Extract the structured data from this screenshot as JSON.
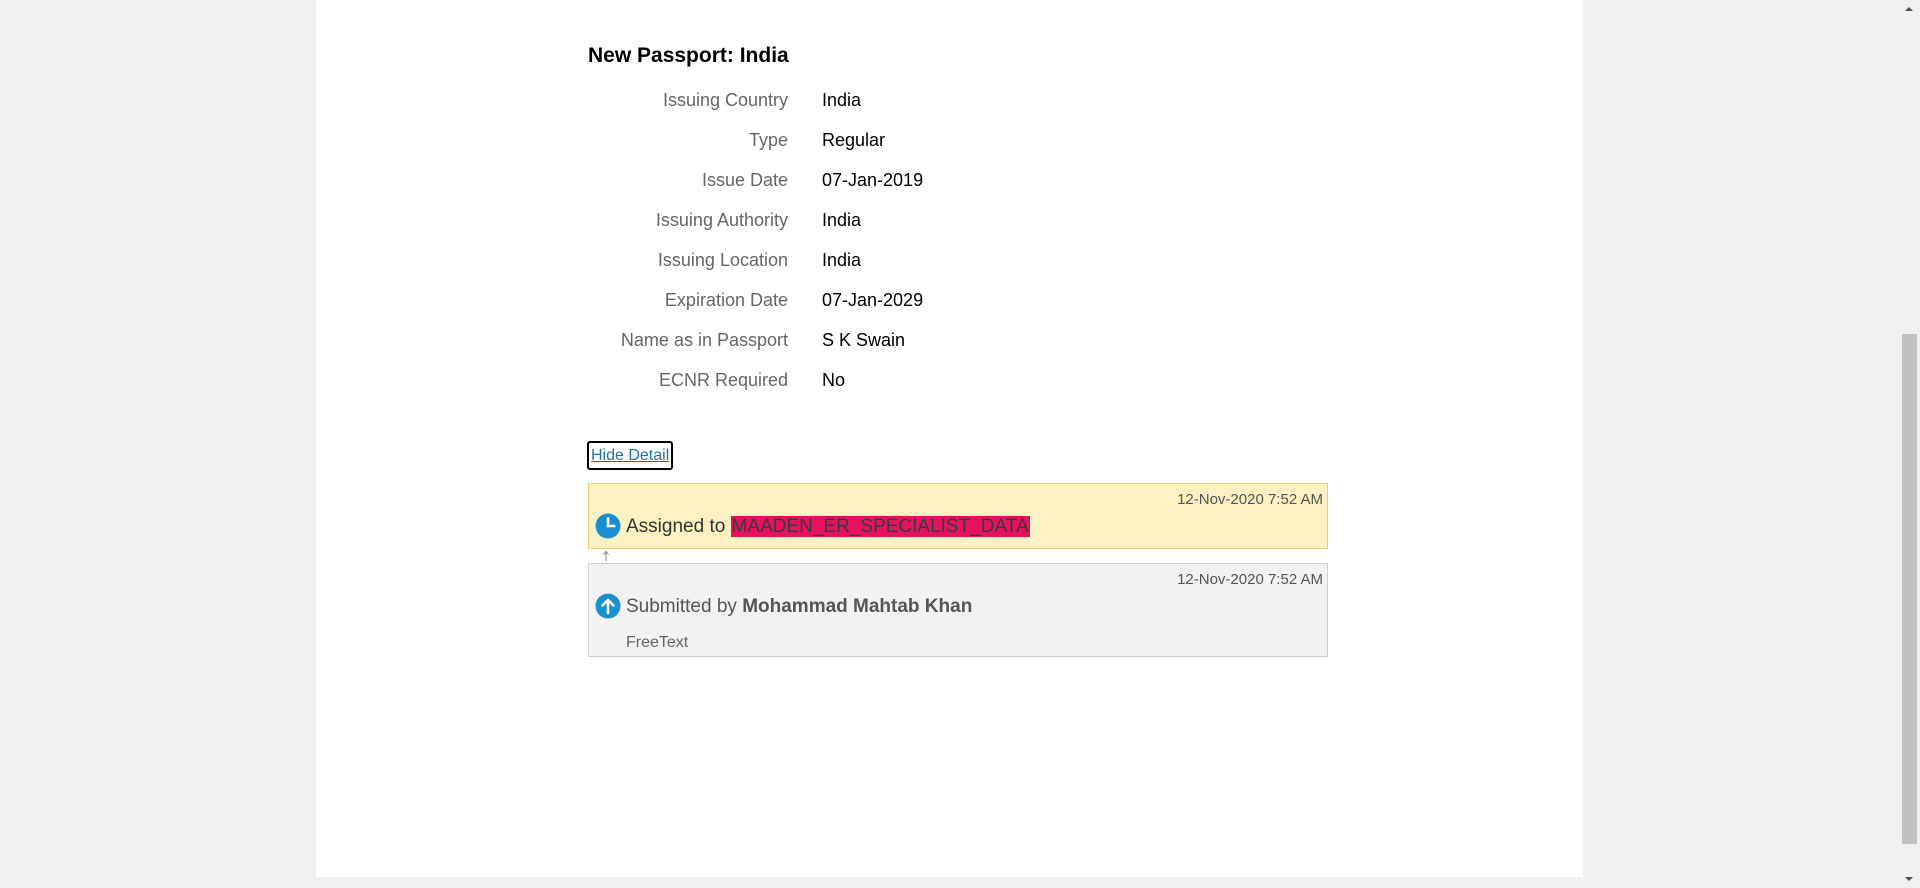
{
  "section": {
    "title": "New Passport: India"
  },
  "details": [
    {
      "label": "Issuing Country",
      "value": "India"
    },
    {
      "label": "Type",
      "value": "Regular"
    },
    {
      "label": "Issue Date",
      "value": "07-Jan-2019"
    },
    {
      "label": "Issuing Authority",
      "value": "India"
    },
    {
      "label": "Issuing Location",
      "value": "India"
    },
    {
      "label": "Expiration Date",
      "value": "07-Jan-2029"
    },
    {
      "label": "Name as in Passport",
      "value": "S K Swain"
    },
    {
      "label": "ECNR Required",
      "value": "No"
    }
  ],
  "actions": {
    "hide_detail": "Hide Detail"
  },
  "history": {
    "pending": {
      "timestamp": "12-Nov-2020 7:52 AM",
      "prefix": "Assigned to",
      "assignee": "MAADEN_ER_SPECIALIST_DATA",
      "icon": "clock-icon"
    },
    "submitted": {
      "timestamp": "12-Nov-2020 7:52 AM",
      "prefix": "Submitted by",
      "submitter": "Mohammad Mahtab Khan",
      "note": "FreeText",
      "icon": "arrow-up-circle-icon"
    }
  },
  "colors": {
    "pending_bg": "#fcf1c2",
    "highlight": "#e6125f",
    "icon_blue": "#1a8fd0",
    "link": "#1f6fb2"
  }
}
